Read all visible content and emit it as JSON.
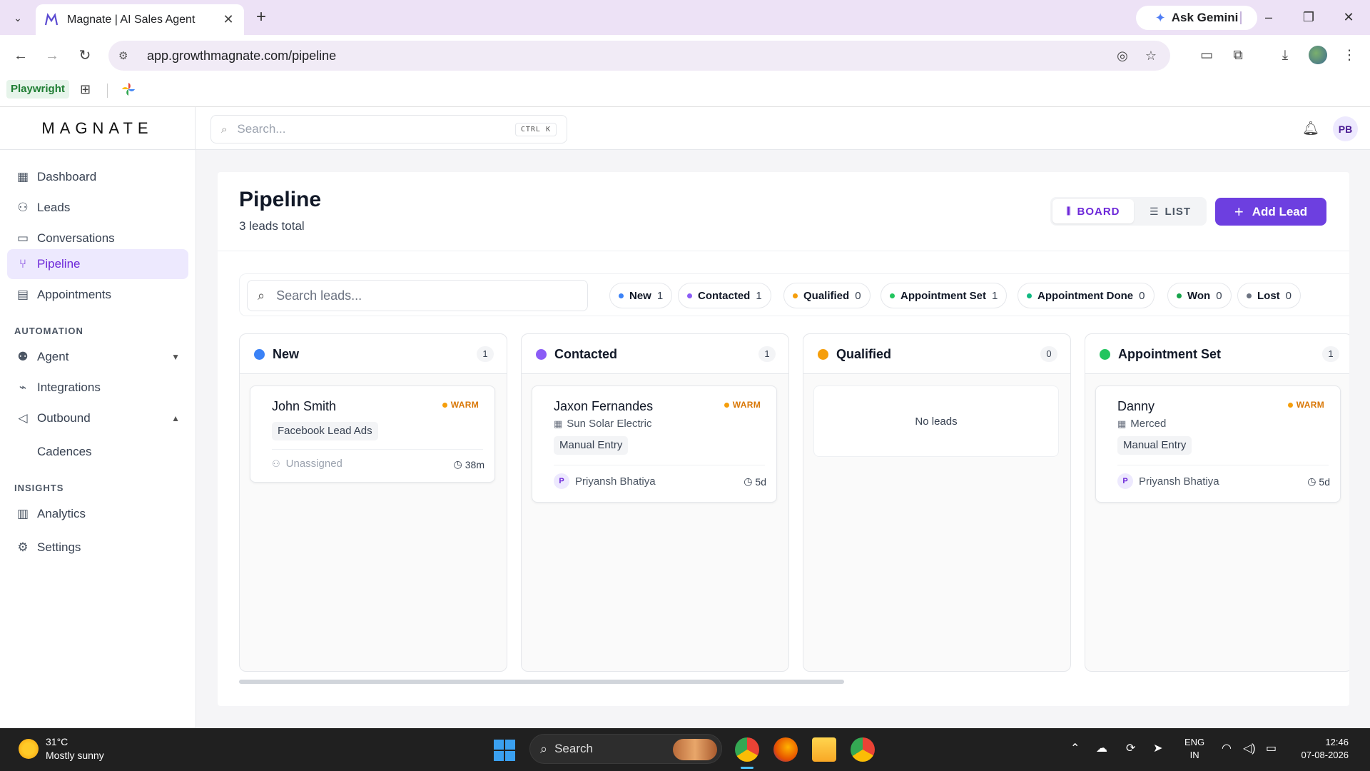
{
  "browser": {
    "tab_title": "Magnate | AI Sales Agent",
    "url": "app.growthmagnate.com/pipeline",
    "gemini_label": "Ask Gemini",
    "bookmark_playwright": "Playwright"
  },
  "app": {
    "logo": "MAGNATE",
    "search_placeholder": "Search...",
    "search_shortcut": "CTRL K",
    "avatar_initials": "PB"
  },
  "sidebar": {
    "items": [
      {
        "label": "Dashboard",
        "icon": "dashboard-icon"
      },
      {
        "label": "Leads",
        "icon": "users-icon"
      },
      {
        "label": "Conversations",
        "icon": "message-icon"
      },
      {
        "label": "Pipeline",
        "icon": "pipeline-icon",
        "active": true
      },
      {
        "label": "Appointments",
        "icon": "calendar-icon"
      }
    ],
    "automation_label": "AUTOMATION",
    "automation_items": [
      {
        "label": "Agent",
        "icon": "bot-icon"
      },
      {
        "label": "Integrations",
        "icon": "plug-icon"
      },
      {
        "label": "Outbound",
        "icon": "megaphone-icon"
      }
    ],
    "outbound_sub": "Cadences",
    "insights_label": "INSIGHTS",
    "insights_items": [
      {
        "label": "Analytics",
        "icon": "bar-chart-icon"
      },
      {
        "label": "Settings",
        "icon": "gear-icon"
      }
    ]
  },
  "pipeline": {
    "title": "Pipeline",
    "subtitle": "3 leads total",
    "view_board": "BOARD",
    "view_list": "LIST",
    "add_lead": "Add Lead",
    "search_placeholder": "Search leads...",
    "filters": [
      {
        "label": "New",
        "count": "1",
        "color": "#3b82f6"
      },
      {
        "label": "Contacted",
        "count": "1",
        "color": "#8b5cf6"
      },
      {
        "label": "Qualified",
        "count": "0",
        "color": "#f59e0b"
      },
      {
        "label": "Appointment Set",
        "count": "1",
        "color": "#22c55e"
      },
      {
        "label": "Appointment Done",
        "count": "0",
        "color": "#10b981"
      },
      {
        "label": "Won",
        "count": "0",
        "color": "#16a34a"
      },
      {
        "label": "Lost",
        "count": "0",
        "color": "#6b7280"
      }
    ],
    "columns": [
      {
        "title": "New",
        "count": "1",
        "color": "#3b82f6"
      },
      {
        "title": "Contacted",
        "count": "1",
        "color": "#8b5cf6"
      },
      {
        "title": "Qualified",
        "count": "0",
        "color": "#f59e0b",
        "empty_text": "No leads"
      },
      {
        "title": "Appointment Set",
        "count": "1",
        "color": "#22c55e"
      }
    ],
    "cards": [
      {
        "name": "John Smith",
        "temp": "WARM",
        "source": "Facebook Lead Ads",
        "owner": "Unassigned",
        "age": "38m"
      },
      {
        "name": "Jaxon Fernandes",
        "temp": "WARM",
        "company": "Sun Solar Electric",
        "source": "Manual Entry",
        "owner_initial": "P",
        "owner": "Priyansh Bhatiya",
        "age": "5d"
      },
      {
        "name": "Danny",
        "temp": "WARM",
        "company": "Merced",
        "source": "Manual Entry",
        "owner_initial": "P",
        "owner": "Priyansh Bhatiya",
        "age": "5d"
      }
    ]
  },
  "taskbar": {
    "temp": "31°C",
    "weather": "Mostly sunny",
    "search": "Search",
    "lang1": "ENG",
    "lang2": "IN",
    "time": "12:46",
    "date": "07-08-2026"
  }
}
